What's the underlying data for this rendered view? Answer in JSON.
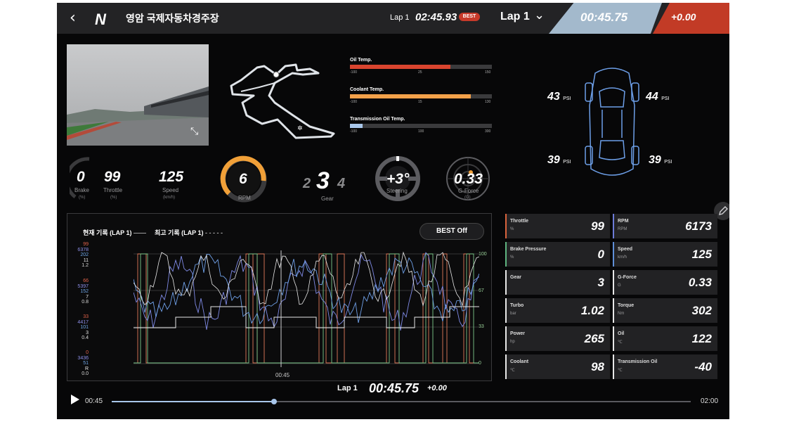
{
  "header": {
    "back_icon": "chevron-left-icon",
    "logo": "N",
    "track_name": "영암 국제자동차경주장",
    "lap_label": "Lap 1",
    "lap_time": "02:45.93",
    "best_badge": "BEST",
    "lap_selector": "Lap 1",
    "current_time": "00:45.75",
    "delta": "+0.00"
  },
  "temps": [
    {
      "label": "Oil Temp.",
      "scale": [
        "-100",
        "25",
        "150"
      ],
      "fill": 0.71,
      "color": "#d9442e"
    },
    {
      "label": "Coolant Temp.",
      "scale": [
        "-100",
        "15",
        "130"
      ],
      "fill": 0.85,
      "color": "#f3a14a"
    },
    {
      "label": "Transmission Oil Temp.",
      "scale": [
        "-100",
        "100",
        "300"
      ],
      "fill": 0.09,
      "color": "#a8c6ea"
    }
  ],
  "gauges": {
    "brake": {
      "value": "0",
      "label": "Brake",
      "unit": "(%)"
    },
    "throttle": {
      "value": "99",
      "label": "Throttle",
      "unit": "(%)"
    },
    "speed": {
      "value": "125",
      "label": "Speed",
      "unit": "(km/h)"
    },
    "rpm": {
      "value": "6",
      "label": "RPM"
    },
    "gear": {
      "prev": "2",
      "current": "3",
      "next": "4",
      "label": "Gear"
    },
    "steering": {
      "value": "+3°",
      "label": "Steering"
    },
    "gforce": {
      "value": "0.33",
      "label": "G-Force",
      "unit": "(G)"
    }
  },
  "tires": {
    "front_left": "43",
    "front_right": "44",
    "rear_left": "39",
    "rear_right": "39",
    "unit": "PSI"
  },
  "graph": {
    "legend_current": "현재 기록 (LAP 1)",
    "legend_best": "최고 기록 (LAP 1)",
    "best_toggle": "BEST Off",
    "cursor_time": "00:45",
    "y_left": [
      [
        "99",
        "6378",
        "202",
        "11",
        "1.2"
      ],
      [
        "66",
        "5397",
        "152",
        "7",
        "0.8"
      ],
      [
        "33",
        "4417",
        "101",
        "3",
        "0.4"
      ],
      [
        "0",
        "3436",
        "51",
        "R",
        "0.0"
      ]
    ],
    "y_right": [
      "100",
      "67",
      "33",
      "0"
    ]
  },
  "footer": {
    "lap_label": "Lap 1",
    "lap_time": "00:45.75",
    "delta": "+0.00",
    "play_icon": "play-icon",
    "elapsed": "00:45",
    "total": "02:00",
    "progress": 0.28
  },
  "stats": [
    {
      "label": "Throttle",
      "unit": "%",
      "value": "99",
      "color": "#d9633d"
    },
    {
      "label": "RPM",
      "unit": "RPM",
      "value": "6173",
      "color": "#6c7bd8"
    },
    {
      "label": "Brake Pressure",
      "unit": "%",
      "value": "0",
      "color": "#5fb580"
    },
    {
      "label": "Speed",
      "unit": "km/h",
      "value": "125",
      "color": "#5f8fd8"
    },
    {
      "label": "Gear",
      "unit": "",
      "value": "3",
      "color": "#e8e8e8"
    },
    {
      "label": "G-Force",
      "unit": "G",
      "value": "0.33",
      "color": "#e8e8e8"
    },
    {
      "label": "Turbo",
      "unit": "bar",
      "value": "1.02",
      "color": "#e8e8e8"
    },
    {
      "label": "Torque",
      "unit": "Nm",
      "value": "302",
      "color": "#e8e8e8"
    },
    {
      "label": "Power",
      "unit": "hp",
      "value": "265",
      "color": "#e8e8e8"
    },
    {
      "label": "Oil",
      "unit": "℃",
      "value": "122",
      "color": "#e8e8e8"
    },
    {
      "label": "Coolant",
      "unit": "℃",
      "value": "98",
      "color": "#e8e8e8"
    },
    {
      "label": "Transmission Oil",
      "unit": "℃",
      "value": "-40",
      "color": "#e8e8e8"
    }
  ]
}
